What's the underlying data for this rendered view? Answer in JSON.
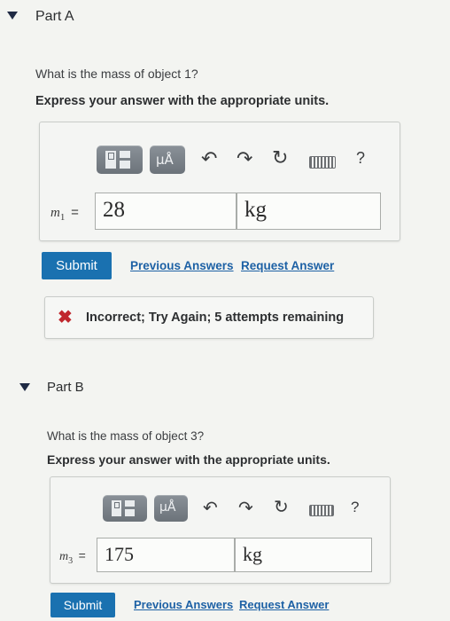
{
  "part_a": {
    "title": "Part A",
    "question": "What is the mass of object 1?",
    "instruction": "Express your answer with the appropriate units.",
    "toolbar": {
      "units_label": "μÅ",
      "help_label": "?"
    },
    "variable": "m",
    "subscript": "1",
    "equals": "=",
    "value": "28",
    "unit": "kg",
    "submit_label": "Submit",
    "previous_answers_label": "Previous Answers",
    "request_answer_label": "Request Answer",
    "feedback": {
      "icon": "x-icon",
      "text": "Incorrect; Try Again; 5 attempts remaining",
      "color": "#c0272d"
    }
  },
  "part_b": {
    "title": "Part B",
    "question": "What is the mass of object 3?",
    "instruction": "Express your answer with the appropriate units.",
    "toolbar": {
      "units_label": "μÅ",
      "help_label": "?"
    },
    "variable": "m",
    "subscript": "3",
    "equals": "=",
    "value": "175",
    "unit": "kg",
    "submit_label": "Submit",
    "previous_answers_label": "Previous Answers",
    "request_answer_label": "Request Answer"
  },
  "colors": {
    "accent": "#1a71b0",
    "link": "#1d61a5",
    "error": "#c0272d"
  }
}
